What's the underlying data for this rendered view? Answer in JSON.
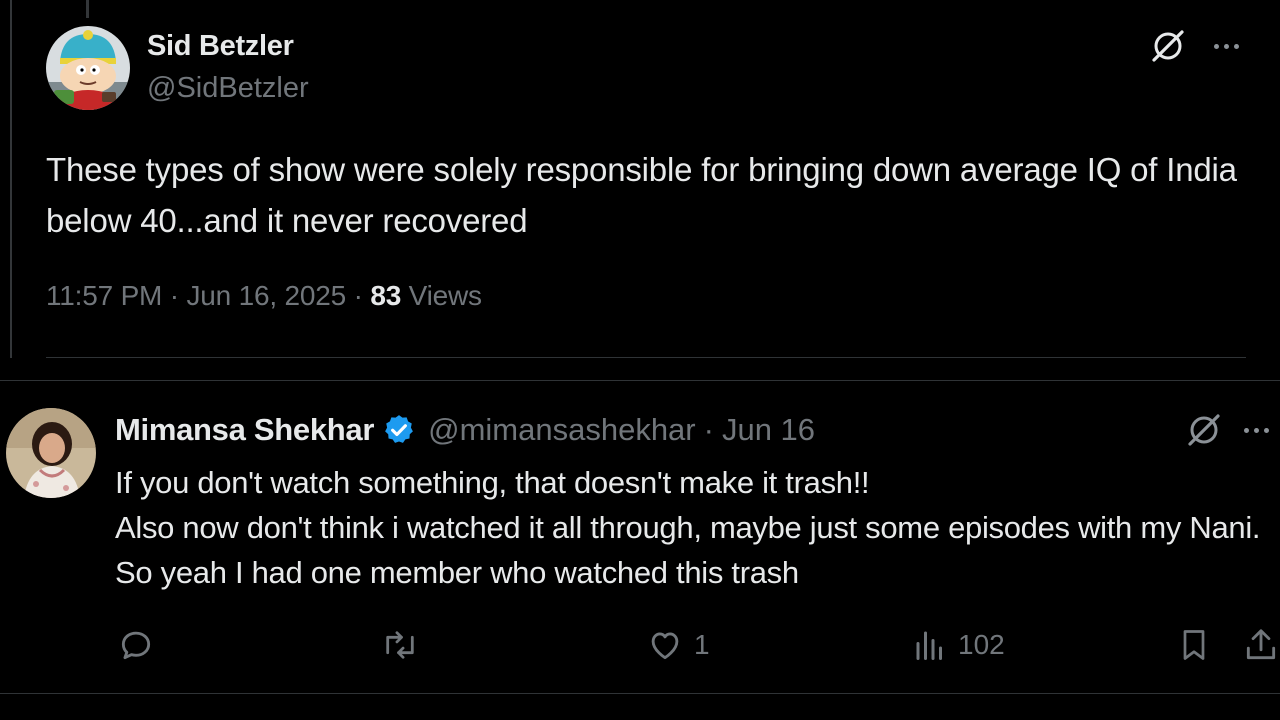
{
  "main_tweet": {
    "author_name": "Sid Betzler",
    "author_handle": "@SidBetzler",
    "text": "These types of show were solely responsible for bringing down average IQ of India below 40...and it never recovered",
    "time": "11:57 PM",
    "date": "Jun 16, 2025",
    "meta_separator": "·",
    "views_count": "83",
    "views_label": "Views",
    "icons": {
      "grok": "grok-icon",
      "more": "more-icon"
    }
  },
  "reply": {
    "author_name": "Mimansa Shekhar",
    "verified": true,
    "author_handle": "@mimansashekhar",
    "separator": "·",
    "date": "Jun 16",
    "text": "If you don't watch something, that doesn't make it trash!!\nAlso  now don't think i watched it all through, maybe just some episodes with my Nani. So yeah I had one member who watched this trash",
    "actions": {
      "reply_count": "",
      "retweet_count": "",
      "like_count": "1",
      "views_count": "102"
    }
  },
  "colors": {
    "background": "#000000",
    "text_primary": "#e7e9ea",
    "text_secondary": "#71767b",
    "divider": "#2f3336",
    "verified_blue": "#1d9bf0"
  }
}
